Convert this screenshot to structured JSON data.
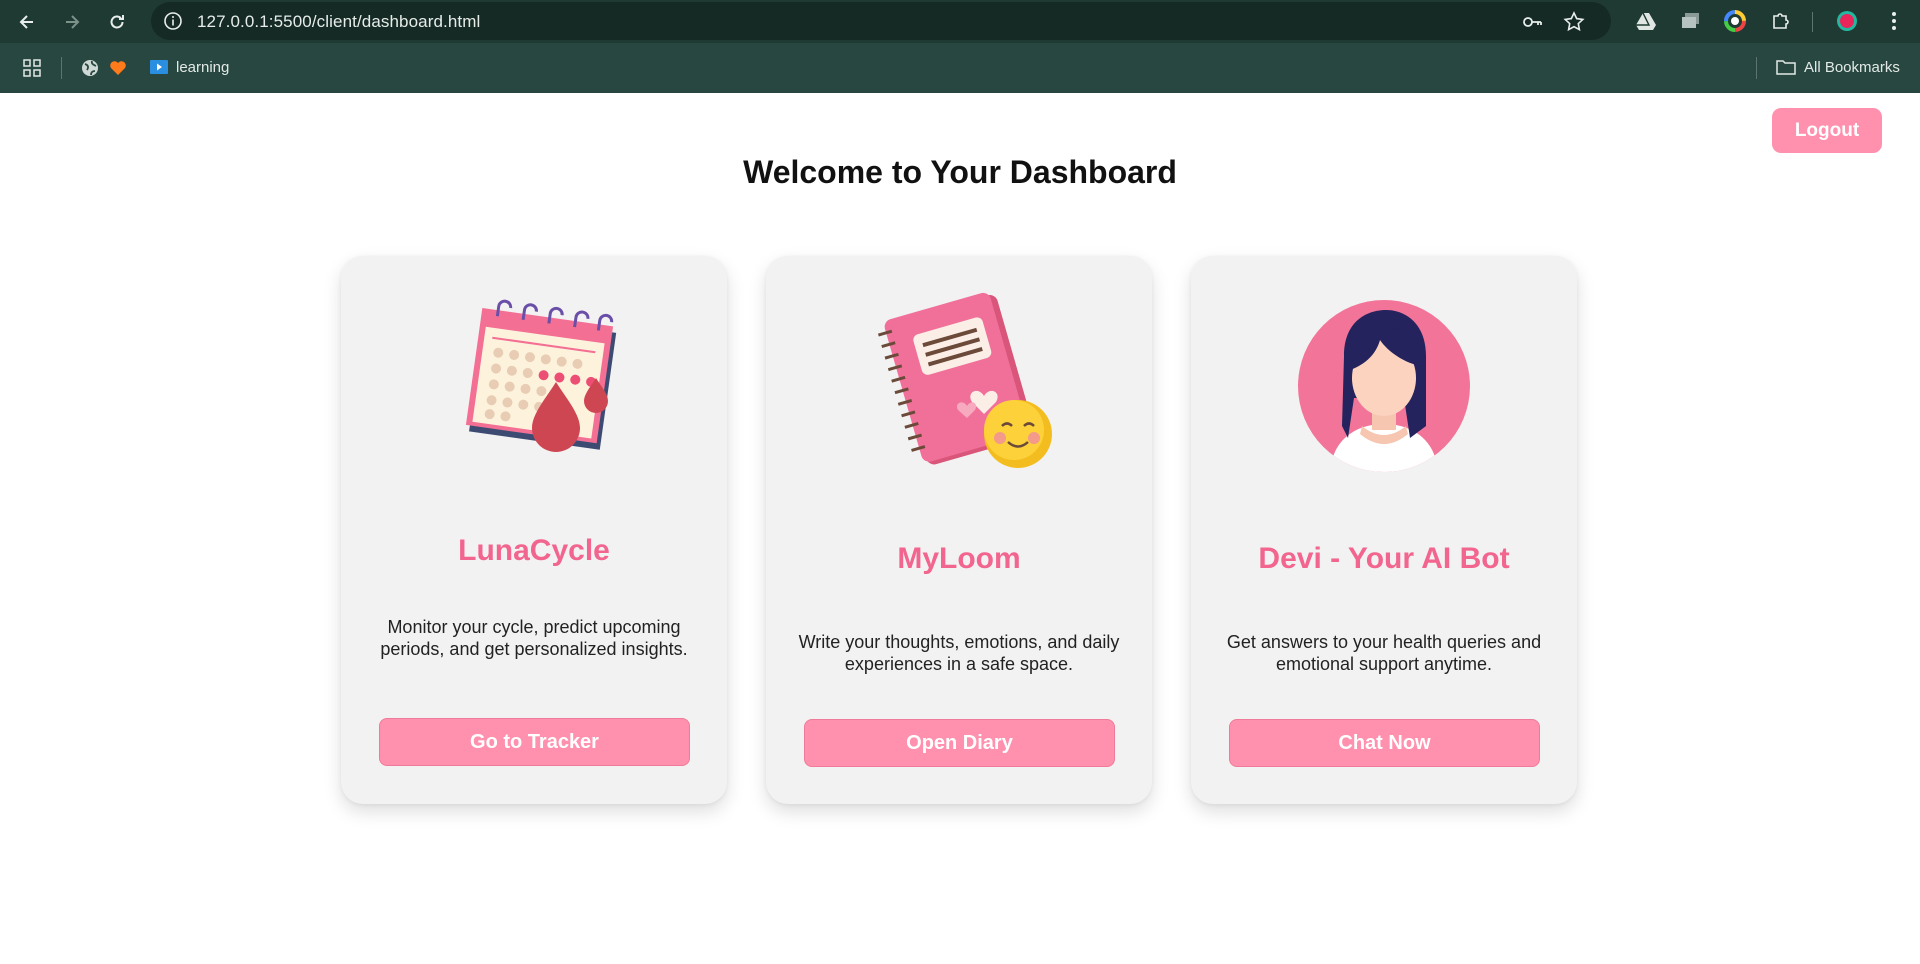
{
  "browser": {
    "url": "127.0.0.1:5500/client/dashboard.html",
    "bookmarks": [
      {
        "label": "learning",
        "icon": "video-folder-icon"
      }
    ],
    "all_bookmarks_label": "All Bookmarks"
  },
  "header": {
    "logout_label": "Logout",
    "title": "Welcome to Your Dashboard"
  },
  "cards": [
    {
      "title": "LunaCycle",
      "description": "Monitor your cycle, predict upcoming periods, and get personalized insights.",
      "button": "Go to Tracker",
      "icon": "calendar-blood-drop-icon"
    },
    {
      "title": "MyLoom",
      "description": "Write your thoughts, emotions, and daily experiences in a safe space.",
      "button": "Open Diary",
      "icon": "diary-smiley-icon"
    },
    {
      "title": "Devi - Your AI Bot",
      "description": "Get answers to your health queries and emotional support anytime.",
      "button": "Chat Now",
      "icon": "woman-avatar-icon"
    }
  ],
  "colors": {
    "accent": "#ff91ae",
    "title_pink": "#f2658f",
    "card_bg": "#f2f2f2",
    "chrome": "#1f3a33"
  }
}
